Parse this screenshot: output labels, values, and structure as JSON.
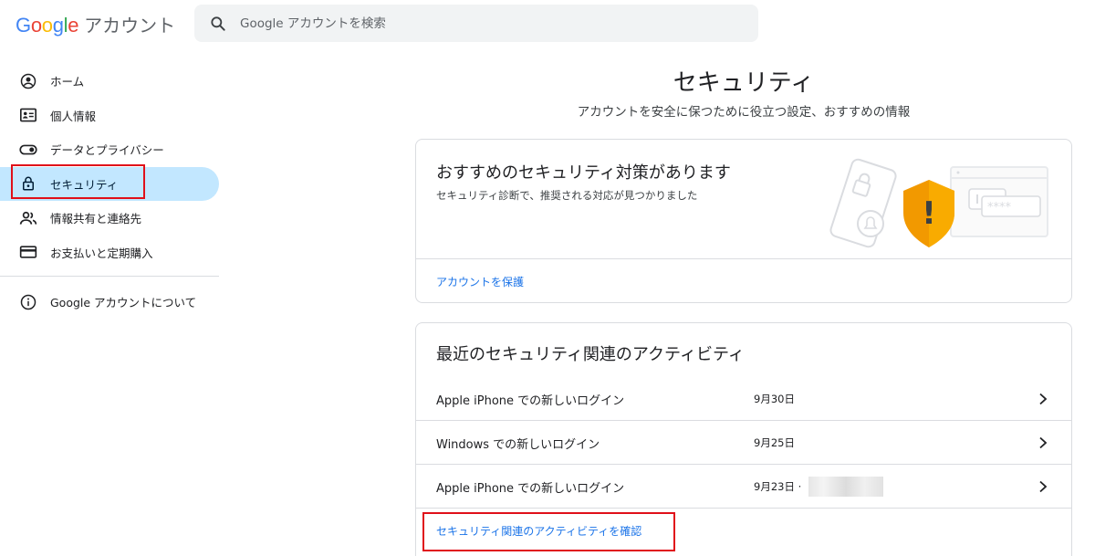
{
  "header": {
    "logo_letters": [
      {
        "ch": "G",
        "color": "#4285F4"
      },
      {
        "ch": "o",
        "color": "#EA4335"
      },
      {
        "ch": "o",
        "color": "#FBBC05"
      },
      {
        "ch": "g",
        "color": "#4285F4"
      },
      {
        "ch": "l",
        "color": "#34A853"
      },
      {
        "ch": "e",
        "color": "#EA4335"
      }
    ],
    "logo_suffix": "アカウント",
    "search_placeholder": "Google アカウントを検索"
  },
  "sidebar": {
    "items": [
      {
        "label": "ホーム",
        "icon": "account-circle-icon"
      },
      {
        "label": "個人情報",
        "icon": "id-card-icon"
      },
      {
        "label": "データとプライバシー",
        "icon": "toggle-icon"
      },
      {
        "label": "セキュリティ",
        "icon": "lock-icon",
        "active": true
      },
      {
        "label": "情報共有と連絡先",
        "icon": "people-icon"
      },
      {
        "label": "お支払いと定期購入",
        "icon": "credit-card-icon"
      }
    ],
    "about": {
      "label": "Google アカウントについて",
      "icon": "info-icon"
    }
  },
  "main": {
    "title": "セキュリティ",
    "subtitle": "アカウントを安全に保つために役立つ設定、おすすめの情報",
    "recommend_card": {
      "title": "おすすめのセキュリティ対策があります",
      "description": "セキュリティ診断で、推奨される対応が見つかりました",
      "link": "アカウントを保護",
      "illus_password": "****",
      "illus_alert": "!"
    },
    "activity_card": {
      "title": "最近のセキュリティ関連のアクティビティ",
      "rows": [
        {
          "text": "Apple iPhone での新しいログイン",
          "date": "9月30日"
        },
        {
          "text": "Windows での新しいログイン",
          "date": "9月25日"
        },
        {
          "text": "Apple iPhone での新しいログイン",
          "date": "9月23日 ·"
        }
      ],
      "link": "セキュリティ関連のアクティビティを確認"
    }
  },
  "colors": {
    "accent": "#1a73e8",
    "active_nav": "#c2e7ff",
    "highlight_box": "#e0101a",
    "shield": "#f29900"
  }
}
